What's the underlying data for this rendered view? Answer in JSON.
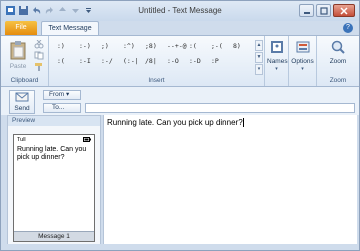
{
  "window": {
    "title": "Untitled - Text Message"
  },
  "tabs": {
    "file": "File",
    "text_message": "Text Message"
  },
  "ribbon": {
    "clipboard": {
      "paste_label": "Paste",
      "group_label": "Clipboard"
    },
    "insert": {
      "group_label": "Insert",
      "emoticons": [
        ":)",
        ":-)",
        ";)",
        ":^)",
        ";8)",
        "--+-@",
        ":(",
        ";-(",
        "8)",
        ":(",
        ":-I",
        ":-/",
        "(:-|",
        "/8|",
        ":-O",
        ":-D",
        ":P",
        ""
      ]
    },
    "names": {
      "label": "Names"
    },
    "options": {
      "label": "Options"
    },
    "zoom": {
      "label": "Zoom",
      "group_label": "Zoom"
    }
  },
  "header": {
    "send_label": "Send",
    "from_label": "From",
    "to_label": "To..."
  },
  "preview": {
    "title": "Preview",
    "signal": "Tull",
    "footer": "Message 1"
  },
  "message": {
    "body": "Running late. Can you pick up dinner?"
  },
  "colors": {
    "file_tab": "#e58c0e",
    "ribbon_bg": "#dde8f5",
    "window_bg": "#cfdcec"
  }
}
